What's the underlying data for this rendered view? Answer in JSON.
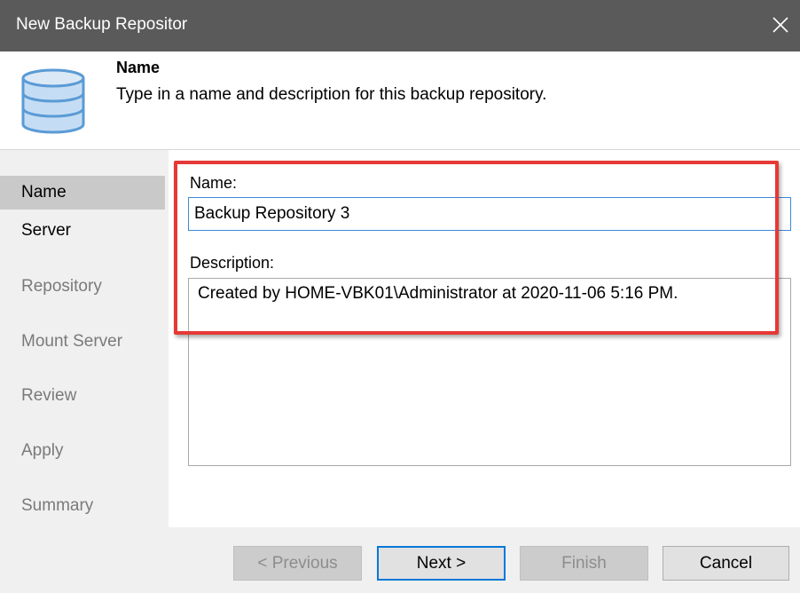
{
  "window": {
    "title": "New Backup Repositor",
    "close_icon": "close-icon"
  },
  "header": {
    "icon": "database-icon",
    "title": "Name",
    "description": "Type in a name and description for this backup repository."
  },
  "steps": [
    {
      "label": "Name",
      "state": "active"
    },
    {
      "label": "Server",
      "state": "next"
    },
    {
      "label": "Repository",
      "state": "pending"
    },
    {
      "label": "Mount Server",
      "state": "pending"
    },
    {
      "label": "Review",
      "state": "pending"
    },
    {
      "label": "Apply",
      "state": "pending"
    },
    {
      "label": "Summary",
      "state": "pending"
    }
  ],
  "form": {
    "name_label": "Name:",
    "name_value": "Backup Repository 3",
    "description_label": "Description:",
    "description_value": "Created by HOME-VBK01\\Administrator at 2020-11-06 5:16 PM."
  },
  "buttons": {
    "previous": "< Previous",
    "next": "Next >",
    "finish": "Finish",
    "cancel": "Cancel"
  },
  "colors": {
    "titlebar": "#5a5a5a",
    "highlight": "#e53935",
    "focus_border": "#3c8ad8",
    "primary_button_border": "#0078d7",
    "database_icon": "#5b9bd5"
  }
}
